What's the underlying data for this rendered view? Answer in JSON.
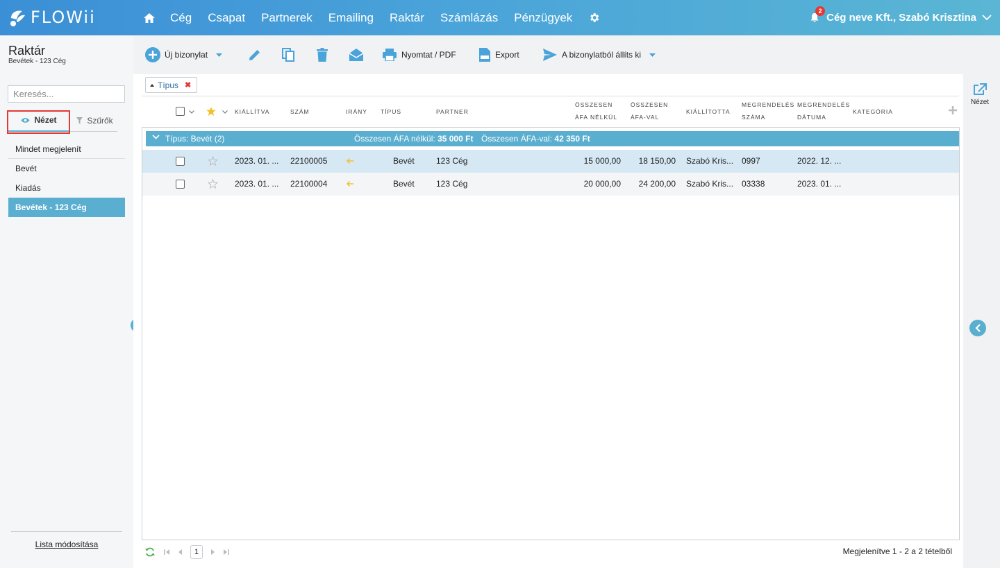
{
  "app": {
    "logo": "FLOWii"
  },
  "nav": {
    "items": [
      {
        "id": "ceg",
        "label": "Cég"
      },
      {
        "id": "csapat",
        "label": "Csapat"
      },
      {
        "id": "partnerek",
        "label": "Partnerek"
      },
      {
        "id": "emailing",
        "label": "Emailing"
      },
      {
        "id": "raktar",
        "label": "Raktár"
      },
      {
        "id": "szamlazas",
        "label": "Számlázás"
      },
      {
        "id": "penzugyek",
        "label": "Pénzügyek"
      }
    ],
    "home_icon": "home-icon",
    "settings_icon": "gear-icon"
  },
  "user": {
    "label": "Cég neve Kft., Szabó Krisztina",
    "notifications": "2"
  },
  "page": {
    "title": "Raktár",
    "subtitle": "Bevétek - 123 Cég"
  },
  "sidebar": {
    "search_placeholder": "Keresés...",
    "tab_view": "Nézet",
    "tab_filters": "Szűrők",
    "items": [
      "Mindet megjelenít",
      "Bevét",
      "Kiadás",
      "Bevétek - 123 Cég"
    ],
    "active_index": 3,
    "footer_link": "Lista módosítása"
  },
  "toolbar": {
    "new_label": "Új bizonylat",
    "print_label": "Nyomtat / PDF",
    "export_label": "Export",
    "send_label": "A bizonylatból állíts ki"
  },
  "filter_chip": {
    "label": "Típus"
  },
  "columns": {
    "issued": "Kiállítva",
    "number": "Szám",
    "direction": "Irány",
    "type": "Típus",
    "partner": "Partner",
    "net_1": "Összesen",
    "net_2": "áfa nélkül",
    "gross_1": "Összesen",
    "gross_2": "áfa-val",
    "issuer": "Kiállította",
    "order_no_1": "Megrendelés",
    "order_no_2": "száma",
    "order_date_1": "Megrendelés",
    "order_date_2": "dátuma",
    "category": "Kategória"
  },
  "group": {
    "title": "Típus: Bevét (2)",
    "sum_net_label": "Összesen ÁFA nélkül:",
    "sum_net_value": "35 000 Ft",
    "sum_gross_label": "Összesen ÁFA-val:",
    "sum_gross_value": "42 350 Ft"
  },
  "rows": [
    {
      "issued": "2023. 01. ...",
      "number": "22100005",
      "type": "Bevét",
      "partner": "123 Cég",
      "net": "15 000,00",
      "gross": "18 150,00",
      "issuer": "Szabó Kris...",
      "order_no": "0997",
      "order_date": "2022. 12. ..."
    },
    {
      "issued": "2023. 01. ...",
      "number": "22100004",
      "type": "Bevét",
      "partner": "123 Cég",
      "net": "20 000,00",
      "gross": "24 200,00",
      "issuer": "Szabó Kris...",
      "order_no": "03338",
      "order_date": "2023. 01. ..."
    }
  ],
  "pager": {
    "page": "1",
    "info": "Megjelenítve 1 - 2 a 2 tételből"
  },
  "right_rail": {
    "view_label": "Nézet"
  },
  "colors": {
    "accent": "#5aaed0",
    "header_start": "#3b8fd6",
    "highlight": "#e53935",
    "selected_row": "#d6e8f4"
  }
}
